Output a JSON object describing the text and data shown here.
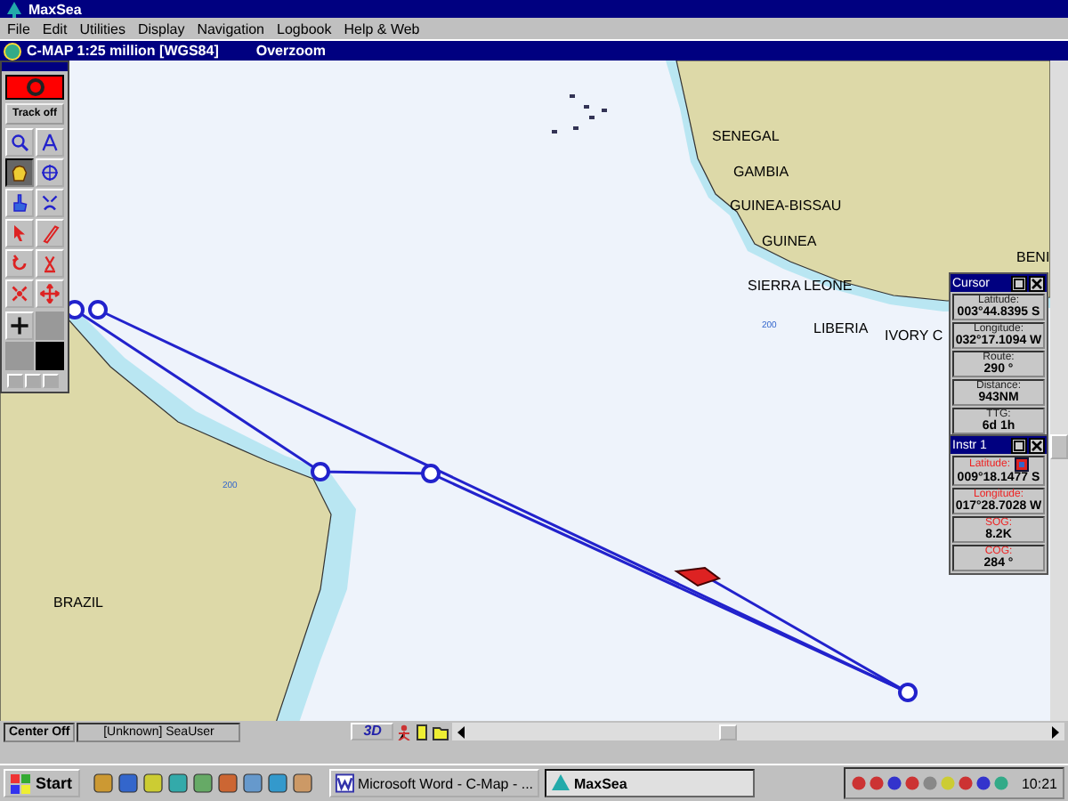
{
  "app": {
    "title": "MaxSea"
  },
  "menu": [
    "File",
    "Edit",
    "Utilities",
    "Display",
    "Navigation",
    "Logbook",
    "Help & Web"
  ],
  "chart_window": {
    "title": "C-MAP  1:25 million [WGS84]",
    "mode": "Overzoom"
  },
  "toolbox": {
    "track_button": "Track off",
    "tools": [
      {
        "kind": "zoom",
        "selected": false
      },
      {
        "kind": "compass",
        "selected": false
      },
      {
        "kind": "hand",
        "selected": true
      },
      {
        "kind": "crosshair",
        "selected": false
      },
      {
        "kind": "finger",
        "selected": false
      },
      {
        "kind": "shrink",
        "selected": false
      },
      {
        "kind": "pointer",
        "selected": false
      },
      {
        "kind": "pencil",
        "selected": false
      },
      {
        "kind": "undo",
        "selected": false
      },
      {
        "kind": "erase",
        "selected": false
      },
      {
        "kind": "spread",
        "selected": false
      },
      {
        "kind": "move",
        "selected": false
      }
    ]
  },
  "map": {
    "labels": [
      "SENEGAL",
      "GAMBIA",
      "GUINEA-BISSAU",
      "GUINEA",
      "SIERRA LEONE",
      "LIBERIA",
      "IVORY C",
      "BENI",
      "BRAZIL"
    ],
    "depth_labels": [
      "200",
      "200"
    ]
  },
  "cursor_panel": {
    "title": "Cursor",
    "fields": [
      {
        "label": "Latitude:",
        "value": "003°44.8395 S"
      },
      {
        "label": "Longitude:",
        "value": "032°17.1094 W"
      },
      {
        "label": "Route:",
        "value": "290 °"
      },
      {
        "label": "Distance:",
        "value": "943NM"
      },
      {
        "label": "TTG:",
        "value": "6d 1h"
      }
    ]
  },
  "instrument_panel": {
    "title": "Instr 1",
    "fields": [
      {
        "label": "Latitude:",
        "value": "009°18.1477 S"
      },
      {
        "label": "Longitude:",
        "value": "017°28.7028 W"
      },
      {
        "label": "SOG:",
        "value": "8.2K"
      },
      {
        "label": "COG:",
        "value": "284 °"
      }
    ]
  },
  "status_bar": {
    "mode": "Center Off",
    "user": "[Unknown] SeaUser",
    "view_button": "3D"
  },
  "taskbar": {
    "start": "Start",
    "tasks": [
      {
        "label": "Microsoft Word - C-Map - ...",
        "selected": false
      },
      {
        "label": "MaxSea",
        "selected": true
      }
    ],
    "clock": "10:21"
  }
}
